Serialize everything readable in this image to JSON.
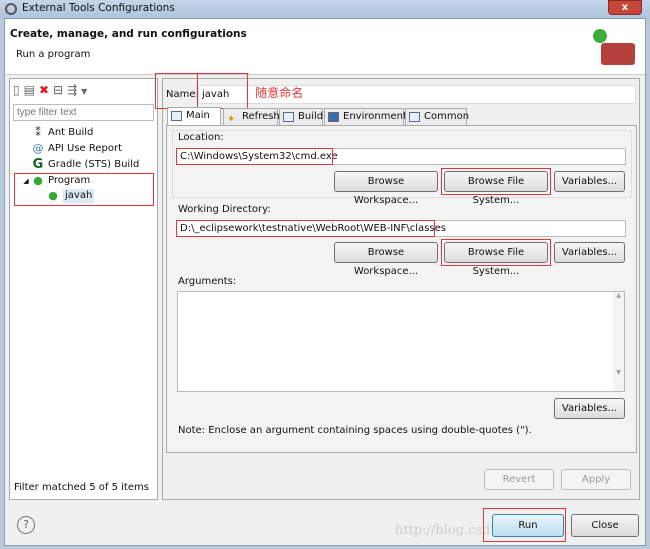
{
  "window": {
    "title": "External Tools Configurations",
    "close": "x"
  },
  "header": {
    "title": "Create, manage, and run configurations",
    "subtitle": "Run a program"
  },
  "left": {
    "filter_placeholder": "type filter text",
    "items": [
      {
        "label": "Ant Build",
        "icon": "ant-icon"
      },
      {
        "label": "API Use Report",
        "icon": "api-report-icon"
      },
      {
        "label": "Gradle (STS) Build",
        "icon": "gradle-icon"
      },
      {
        "label": "Program",
        "icon": "program-icon",
        "expanded": true
      },
      {
        "label": "javah",
        "icon": "program-config-icon",
        "selected": true
      }
    ],
    "status": "Filter matched 5 of 5 items"
  },
  "config": {
    "name_label": "Name:",
    "name_value": "javah",
    "annotation": "随意命名",
    "tabs": [
      "Main",
      "Refresh",
      "Build",
      "Environment",
      "Common"
    ],
    "active_tab": "Main",
    "location_label": "Location:",
    "location_value": "C:\\Windows\\System32\\cmd.exe",
    "workdir_label": "Working Directory:",
    "workdir_value": "D:\\_eclipsework\\testnative\\WebRoot\\WEB-INF\\classes",
    "browse_workspace": "Browse Workspace...",
    "browse_fs": "Browse File System...",
    "variables": "Variables...",
    "arguments_label": "Arguments:",
    "arguments_value": "",
    "note": "Note: Enclose an argument containing spaces using double-quotes (\").",
    "revert": "Revert",
    "apply": "Apply"
  },
  "footer": {
    "run": "Run",
    "close": "Close",
    "watermark": "http://blog.csdn.net/"
  },
  "colors": {
    "highlight": "#e0383a"
  }
}
